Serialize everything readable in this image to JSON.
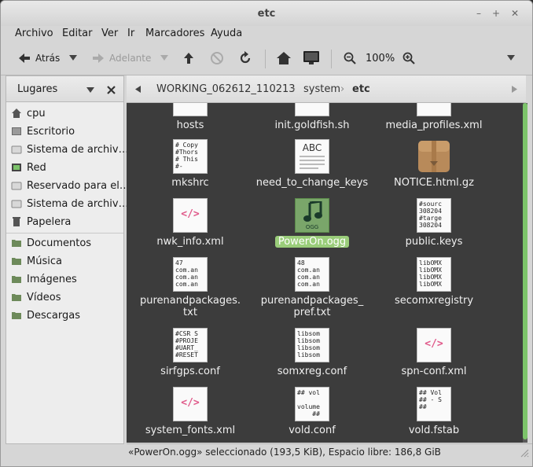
{
  "window": {
    "title": "etc"
  },
  "menubar": [
    "Archivo",
    "Editar",
    "Ver",
    "Ir",
    "Marcadores",
    "Ayuda"
  ],
  "toolbar": {
    "back_label": "Atrás",
    "forward_label": "Adelante",
    "zoom_level": "100%"
  },
  "sidebar": {
    "header_label": "Lugares",
    "items": [
      {
        "label": "cpu",
        "icon": "home-icon"
      },
      {
        "label": "Escritorio",
        "icon": "desktop-icon"
      },
      {
        "label": "Sistema de archiv…",
        "icon": "drive-icon"
      },
      {
        "label": "Red",
        "icon": "network-icon"
      },
      {
        "label": "Reservado para el…",
        "icon": "drive-icon"
      },
      {
        "label": "Sistema de archiv…",
        "icon": "drive-icon"
      },
      {
        "label": "Papelera",
        "icon": "trash-icon"
      },
      {
        "label": "Documentos",
        "icon": "folder-icon"
      },
      {
        "label": "Música",
        "icon": "folder-icon"
      },
      {
        "label": "Imágenes",
        "icon": "folder-icon"
      },
      {
        "label": "Vídeos",
        "icon": "folder-icon"
      },
      {
        "label": "Descargas",
        "icon": "folder-icon"
      }
    ]
  },
  "pathbar": {
    "crumbs": [
      "WORKING_062612_110213",
      "system",
      "etc"
    ]
  },
  "files": [
    {
      "name": "hosts",
      "kind": "text",
      "preview": ""
    },
    {
      "name": "init.goldfish.sh",
      "kind": "text",
      "preview": ""
    },
    {
      "name": "media_profiles.xml",
      "kind": "text",
      "preview": ""
    },
    {
      "name": "mkshrc",
      "kind": "text",
      "preview": "# Copy\n#Thors\n# This\n#-"
    },
    {
      "name": "need_to_change_keys",
      "kind": "abc",
      "preview": "ABC"
    },
    {
      "name": "NOTICE.html.gz",
      "kind": "archive",
      "preview": ""
    },
    {
      "name": "nwk_info.xml",
      "kind": "xml",
      "preview": "</>"
    },
    {
      "name": "PowerOn.ogg",
      "kind": "audio",
      "preview": "OGG",
      "selected": true
    },
    {
      "name": "public.keys",
      "kind": "text",
      "preview": "#sourc\n308204\n#targe\n308204"
    },
    {
      "name": "purenandpackages.\ntxt",
      "kind": "text",
      "preview": "47\ncom.an\ncom.an\ncom.an"
    },
    {
      "name": "purenandpackages_\npref.txt",
      "kind": "text",
      "preview": "48\ncom.an\ncom.an\ncom.an"
    },
    {
      "name": "secomxregistry",
      "kind": "text",
      "preview": "libOMX\nlibOMX\nlibOMX\nlibOMX"
    },
    {
      "name": "sirfgps.conf",
      "kind": "text",
      "preview": "#CSR S\n#PROJE\n#UART_\n#RESET"
    },
    {
      "name": "somxreg.conf",
      "kind": "text",
      "preview": "libsom\nlibsom\nlibsom\nlibsom"
    },
    {
      "name": "spn-conf.xml",
      "kind": "xml",
      "preview": "</>"
    },
    {
      "name": "system_fonts.xml",
      "kind": "xml",
      "preview": "</>"
    },
    {
      "name": "vold.conf",
      "kind": "text",
      "preview": "## vol\n\nvolume\n    ##"
    },
    {
      "name": "vold.fstab",
      "kind": "text",
      "preview": "## Vol\n## - S\n##"
    }
  ],
  "statusbar": {
    "text": "«PowerOn.ogg» seleccionado (193,5 KiB), Espacio libre: 186,8 GiB"
  },
  "colors": {
    "selection": "#9acd7a",
    "accent_green": "#7cc36a",
    "content_bg": "#3c3c3c"
  }
}
